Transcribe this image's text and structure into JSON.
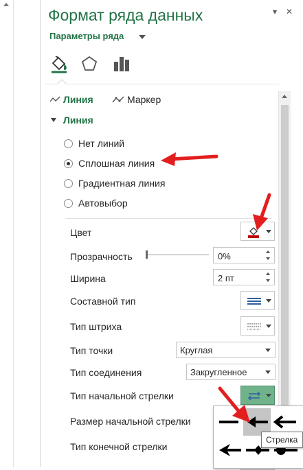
{
  "pane": {
    "title": "Формат ряда данных",
    "options_label": "Параметры ряда",
    "tabs": [
      "fill-and-line",
      "effects",
      "series-options"
    ],
    "subtabs": {
      "line": "Линия",
      "marker": "Маркер"
    },
    "section": "Линия"
  },
  "radios": [
    {
      "label": "Нет линий",
      "selected": false
    },
    {
      "label": "Сплошная линия",
      "selected": true
    },
    {
      "label": "Градиентная линия",
      "selected": false
    },
    {
      "label": "Автовыбор",
      "selected": false
    }
  ],
  "props": {
    "color": "Цвет",
    "transparency": "Прозрачность",
    "transparency_value": "0%",
    "width": "Ширина",
    "width_value": "2 пт",
    "compound_type": "Составной тип",
    "dash_type": "Тип штриха",
    "cap_type": "Тип точки",
    "cap_value": "Круглая",
    "join_type": "Тип соединения",
    "join_value": "Закругленное",
    "begin_arrow_type": "Тип начальной стрелки",
    "begin_arrow_size": "Размер начальной стрелки",
    "end_arrow_type": "Тип конечной стрелки"
  },
  "tooltip": "Стрелка",
  "colors": {
    "accent": "#217346",
    "line_color": "#c00000",
    "annotation": "#e31e1e",
    "selected_arrow_btn": "#70b28a"
  }
}
